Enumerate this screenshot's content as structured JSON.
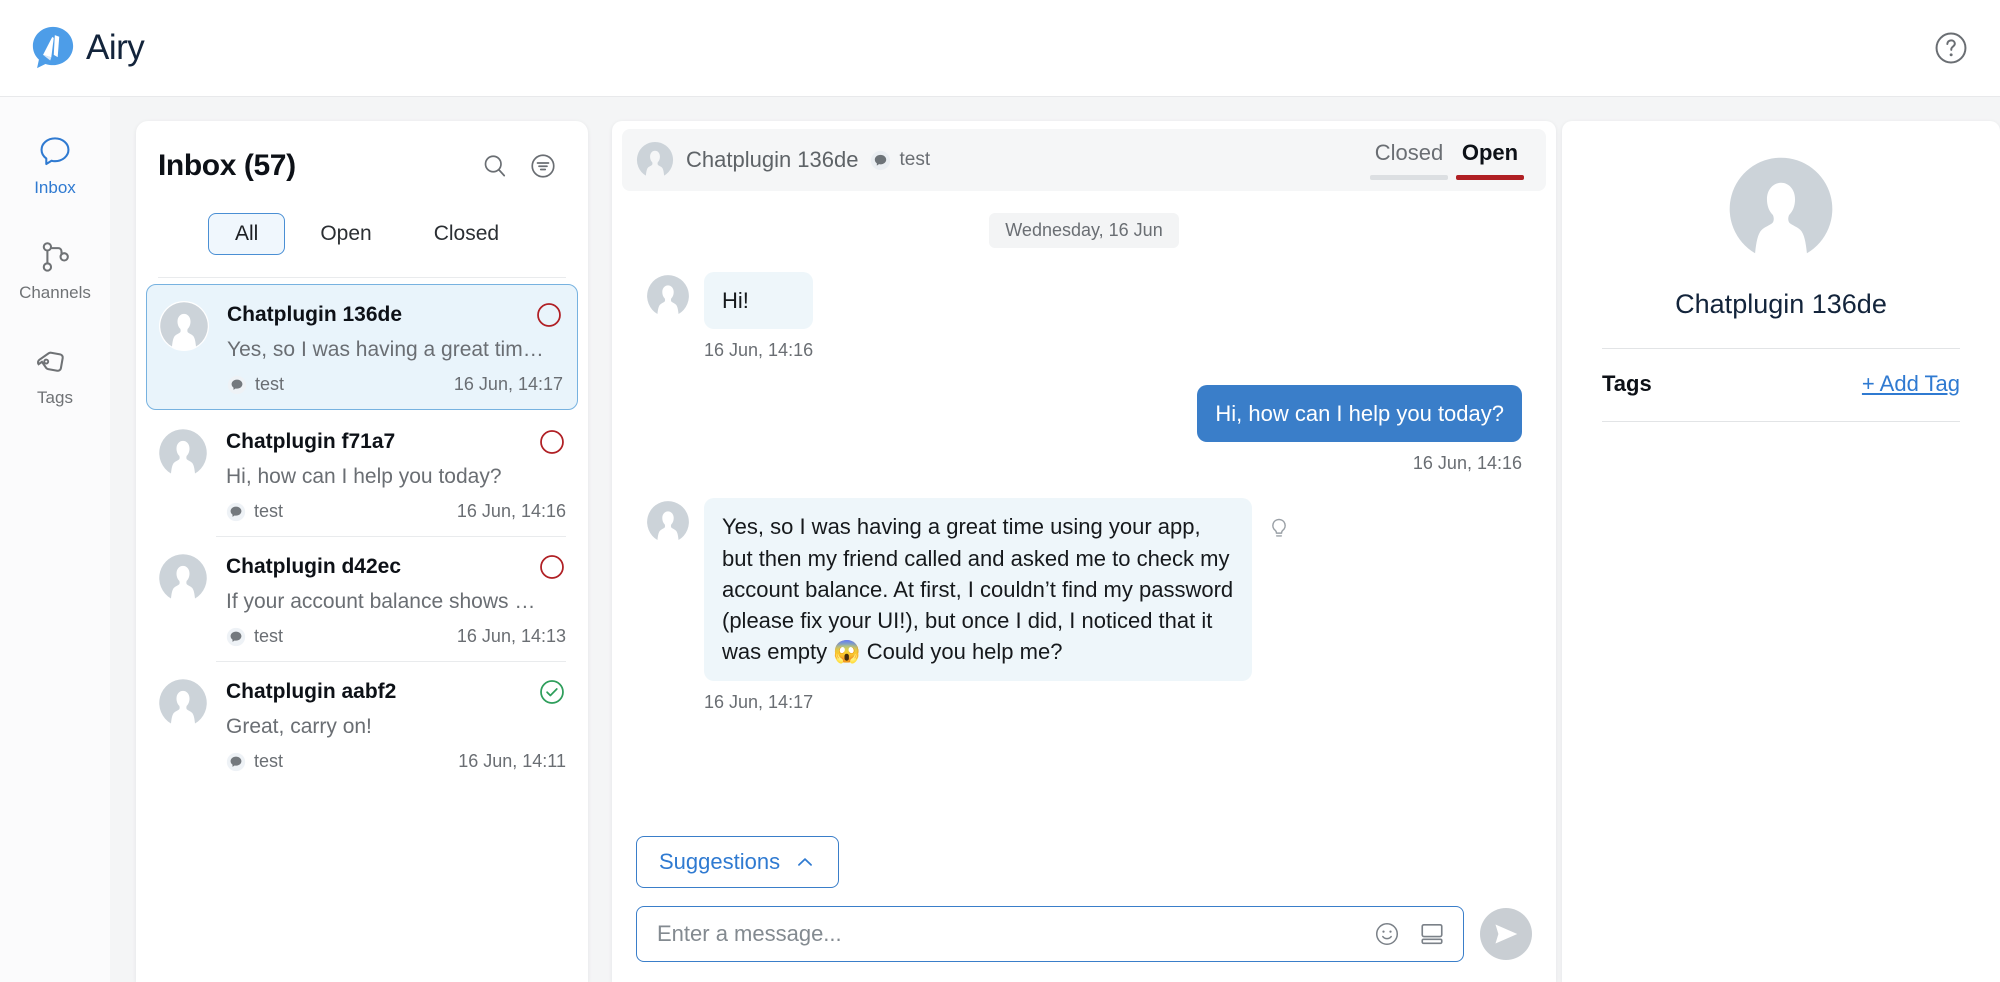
{
  "app": {
    "brand_name": "Airy",
    "logo_icon": "airy-logo-speech-bubble",
    "help_icon": "question-mark-circle-icon",
    "accent_blue": "#2f7ad1",
    "bubble_blue": "#3a7ec9",
    "open_red": "#b01f24",
    "closed_green": "#2e9e5b"
  },
  "sidebar": {
    "items": [
      {
        "label": "Inbox",
        "icon": "speech-bubble-icon",
        "active": true
      },
      {
        "label": "Channels",
        "icon": "channels-nodes-icon",
        "active": false
      },
      {
        "label": "Tags",
        "icon": "tag-icon",
        "active": false
      }
    ]
  },
  "inbox": {
    "title": "Inbox (57)",
    "search_icon": "search-icon",
    "filter_icon": "filter-icon",
    "tabs": [
      {
        "label": "All",
        "active": true
      },
      {
        "label": "Open",
        "active": false
      },
      {
        "label": "Closed",
        "active": false
      }
    ],
    "conversations": [
      {
        "name": "Chatplugin 136de",
        "preview": "Yes, so I was having a great tim…",
        "source": "test",
        "time": "16 Jun, 14:17",
        "status": "open",
        "selected": true
      },
      {
        "name": "Chatplugin f71a7",
        "preview": "Hi, how can I help you today?",
        "source": "test",
        "time": "16 Jun, 14:16",
        "status": "open",
        "selected": false
      },
      {
        "name": "Chatplugin d42ec",
        "preview": "If your account balance shows …",
        "source": "test",
        "time": "16 Jun, 14:13",
        "status": "open",
        "selected": false
      },
      {
        "name": "Chatplugin aabf2",
        "preview": "Great, carry on!",
        "source": "test",
        "time": "16 Jun, 14:11",
        "status": "closed",
        "selected": false
      }
    ]
  },
  "chat": {
    "header": {
      "contact_name": "Chatplugin 136de",
      "source": "test",
      "state_closed_label": "Closed",
      "state_open_label": "Open",
      "active_state": "Open"
    },
    "date_separator": "Wednesday, 16 Jun",
    "messages": [
      {
        "direction": "in",
        "text": "Hi!",
        "time": "16 Jun, 14:16"
      },
      {
        "direction": "out",
        "text": "Hi, how can I help you today?",
        "time": "16 Jun, 14:16"
      },
      {
        "direction": "in",
        "text": "Yes, so I was having a great time using your app, but then my friend called and asked me to check my account balance. At first, I couldn’t find my password (please fix your UI!), but once I did, I noticed that it was empty 😱 Could you help me?",
        "time": "16 Jun, 14:17",
        "suggestion_icon": "lightbulb-icon"
      }
    ],
    "composer": {
      "suggestions_label": "Suggestions",
      "suggestions_chevron": "chevron-up-icon",
      "input_placeholder": "Enter a message...",
      "input_value": "",
      "emoji_icon": "smiley-face-icon",
      "template_icon": "template-card-icon",
      "send_icon": "send-paper-plane-icon"
    }
  },
  "contact": {
    "avatar_icon": "avatar-placeholder-icon",
    "name": "Chatplugin 136de",
    "tags_label": "Tags",
    "add_tag_label": "+ Add Tag"
  }
}
